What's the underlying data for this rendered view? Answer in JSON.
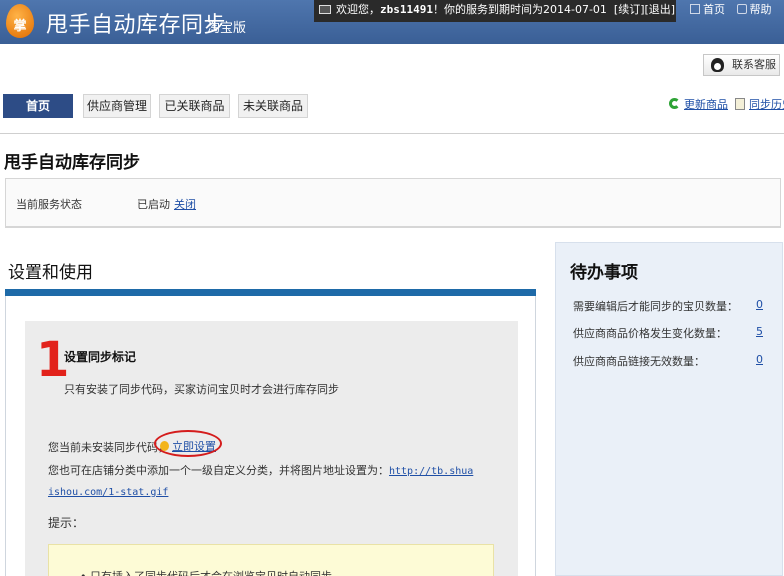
{
  "header": {
    "logo_char": "掌",
    "title": "甩手自动库存同步",
    "subtitle": "淘宝版",
    "welcome_prefix": "欢迎您，",
    "username": "zbs11491",
    "welcome_suffix": "！你的服务到期时间为2014-07-01",
    "renew_label": "[续订]",
    "logout_label": "[退出]",
    "home_label": "首页",
    "help_label": "帮助"
  },
  "contact": {
    "label": "联系客服"
  },
  "nav": {
    "tabs": [
      {
        "label": "首页",
        "active": true
      },
      {
        "label": "供应商管理",
        "active": false
      },
      {
        "label": "已关联商品",
        "active": false
      },
      {
        "label": "未关联商品",
        "active": false
      }
    ],
    "update_goods_label": "更新商品",
    "sync_history_label": "同步历史"
  },
  "page": {
    "title": "甩手自动库存同步",
    "status_label": "当前服务状态",
    "status_value": "已启动",
    "close_label": "关闭"
  },
  "setup": {
    "section_title": "设置和使用",
    "step_number": "1",
    "step_title": "设置同步标记",
    "step_desc": "只有安装了同步代码，买家访问宝贝时才会进行库存同步",
    "not_installed": "您当前未安装同步代码，",
    "setup_now": "立即设置",
    "alt_text": "您也可在店铺分类中添加一个一级自定义分类，并将图片地址设置为：",
    "image_url": "http://tb.shuaishou.com/1-stat.gif",
    "tips_label": "提示：",
    "tip_line": "• 只有插入了同步代码后才会在浏览宝贝时自动同步"
  },
  "todo": {
    "title": "待办事项",
    "items": [
      {
        "label": "需要编辑后才能同步的宝贝数量：",
        "count": "0"
      },
      {
        "label": "供应商商品价格发生变化数量：",
        "count": "5"
      },
      {
        "label": "供应商商品链接无效数量：",
        "count": "0"
      }
    ]
  },
  "colors": {
    "header_blue": "#3a5f96",
    "active_tab": "#2d4c86",
    "step_red": "#e2221b",
    "link_blue": "#1f4fa6",
    "sidebar_bg": "#eaf0f8"
  }
}
